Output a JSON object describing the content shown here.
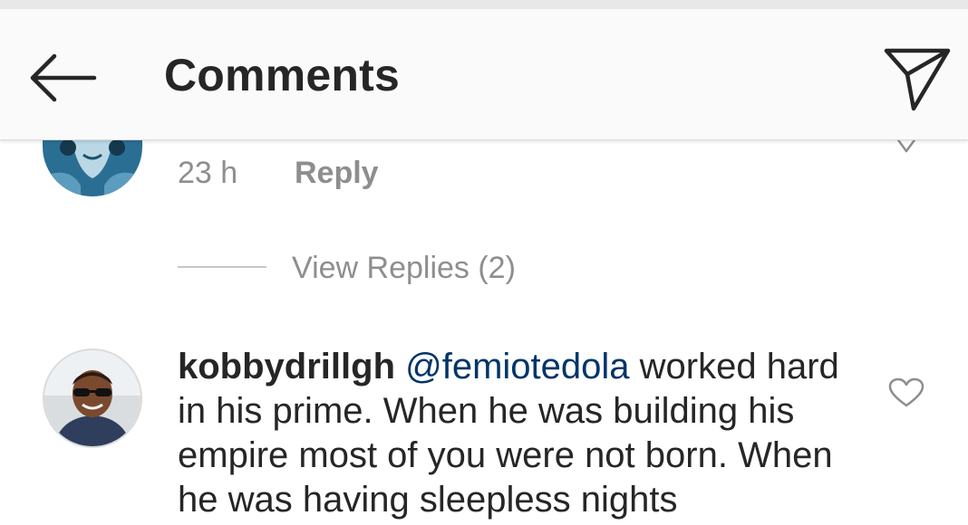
{
  "header": {
    "title": "Comments",
    "back_icon": "arrow-left-icon",
    "share_icon": "paper-plane-icon"
  },
  "comments": [
    {
      "time": "23 h",
      "reply_label": "Reply",
      "view_replies": "View Replies (2)"
    },
    {
      "username": "kobbydrillgh",
      "mention": "@femiotedola",
      "text": " worked hard in his prime. When he was building his empire most of you were not born. When he was having sleepless nights"
    }
  ],
  "colors": {
    "text": "#262626",
    "secondary": "#8e8e8e",
    "mention": "#003569",
    "header_bg": "#fafafa"
  }
}
